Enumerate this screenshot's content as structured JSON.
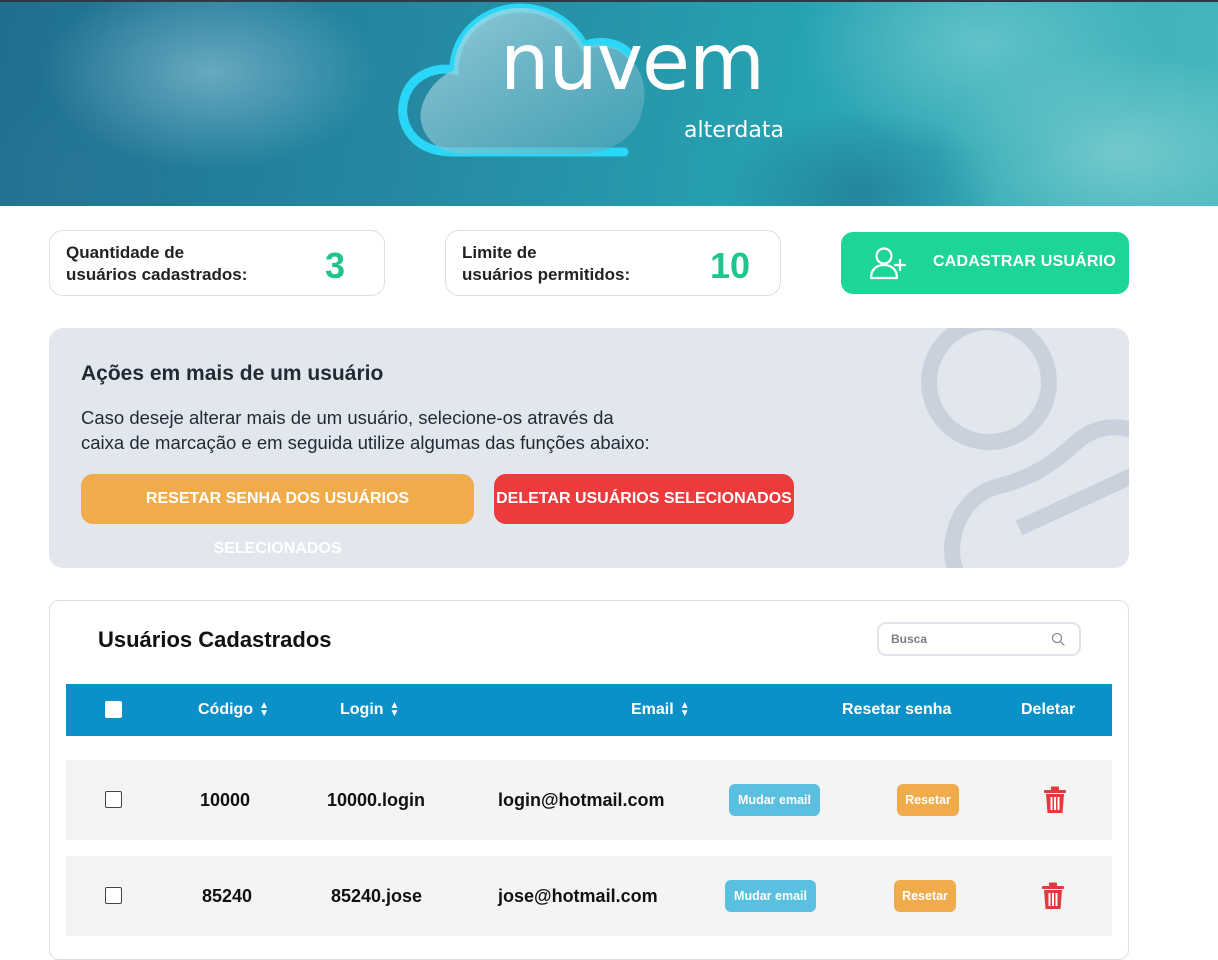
{
  "brand": {
    "name": "nuvem",
    "sub": "alterdata",
    "colors": {
      "accent_green": "#1ed598",
      "header_blue": "#0a92c8",
      "warning_orange": "#f0ac4b",
      "danger_red": "#ec3a3d"
    }
  },
  "stats": {
    "registered": {
      "label_line1": "Quantidade de",
      "label_line2": "usuários cadastrados:",
      "value": "3"
    },
    "limit": {
      "label_line1": "Limite de",
      "label_line2": "usuários permitidos:",
      "value": "10"
    },
    "register_button": {
      "label": "CADASTRAR USUÁRIO",
      "icon": "user-plus-icon"
    }
  },
  "bulk_actions": {
    "title": "Ações em mais de um usuário",
    "description_line1": "Caso deseje alterar mais de um usuário, selecione-os através da",
    "description_line2": "caixa de marcação e em seguida utilize algumas das funções abaixo:",
    "reset_selected_label": "RESETAR SENHA DOS USUÁRIOS SELECIONADOS",
    "delete_selected_label": "DELETAR USUÁRIOS SELECIONADOS"
  },
  "users": {
    "title": "Usuários Cadastrados",
    "search": {
      "placeholder": "Busca",
      "value": ""
    },
    "columns": {
      "codigo": "Código",
      "login": "Login",
      "email": "Email",
      "reset": "Resetar senha",
      "delete": "Deletar"
    },
    "change_email_label": "Mudar email",
    "reset_label": "Resetar",
    "rows": [
      {
        "codigo": "10000",
        "login": "10000.login",
        "email": "login@hotmail.com"
      },
      {
        "codigo": "85240",
        "login": "85240.jose",
        "email": "jose@hotmail.com"
      }
    ]
  }
}
